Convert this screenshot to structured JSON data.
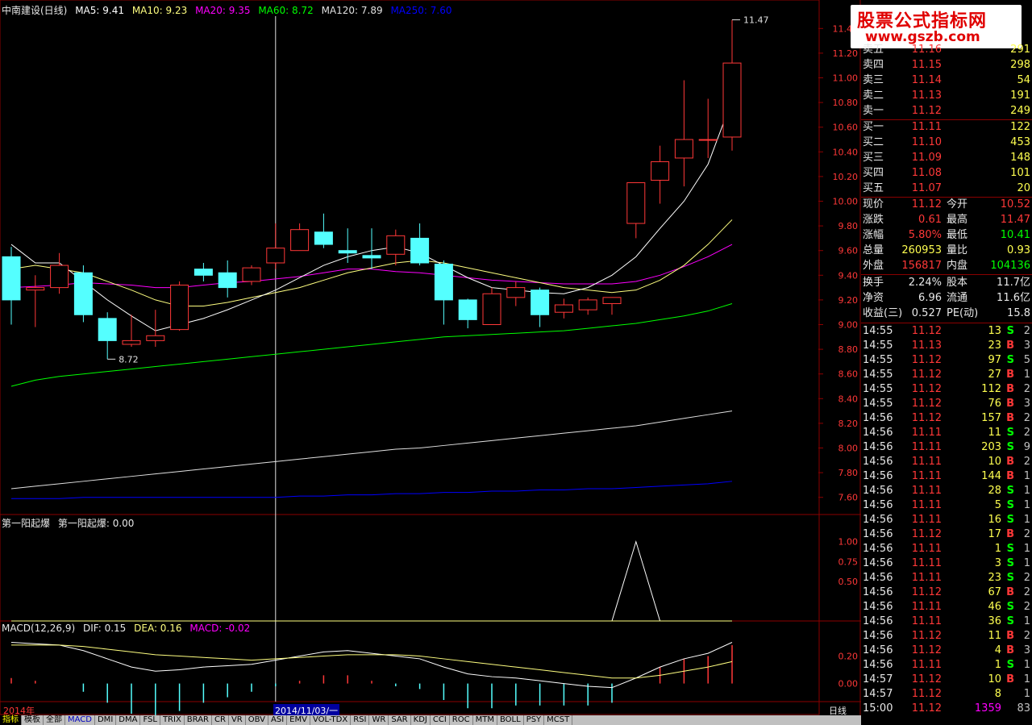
{
  "main_legend": {
    "title": "中南建设(日线)",
    "items": [
      {
        "text": "MA5: 9.41",
        "color": "#ffffff"
      },
      {
        "text": "MA10: 9.23",
        "color": "#ffff80"
      },
      {
        "text": "MA20: 9.35",
        "color": "#ff00ff"
      },
      {
        "text": "MA60: 8.72",
        "color": "#00ff00"
      },
      {
        "text": "MA120: 7.89",
        "color": "#e0e0e0"
      },
      {
        "text": "MA250: 7.60",
        "color": "#0000ff"
      }
    ]
  },
  "logo": {
    "line1": "股票公式指标网",
    "line2": "www.gszb.com"
  },
  "annotations": {
    "high": "11.47",
    "low": "8.72"
  },
  "sub1_legend": {
    "name": "第一阳起爆",
    "value_text": "第一阳起爆: 0.00"
  },
  "sub2_legend": {
    "name": "MACD(12,26,9)",
    "dif": "DIF: 0.15",
    "dea": "DEA: 0.16",
    "macd": "MACD: -0.02"
  },
  "date_axis": {
    "left": "2014年",
    "cursor": "2014/11/03/一"
  },
  "period_label": "日线",
  "price_axis": [
    "11.40",
    "11.20",
    "11.00",
    "10.80",
    "10.60",
    "10.40",
    "10.20",
    "10.00",
    "9.80",
    "9.60",
    "9.40",
    "9.20",
    "9.00",
    "8.80",
    "8.60",
    "8.40",
    "8.20",
    "8.00",
    "7.80",
    "7.60"
  ],
  "sub1_axis": [
    "1.00",
    "0.75",
    "0.50"
  ],
  "sub2_axis": [
    "0.20",
    "0.00"
  ],
  "asks": [
    {
      "label": "卖五",
      "price": "11.16",
      "vol": "291"
    },
    {
      "label": "卖四",
      "price": "11.15",
      "vol": "298"
    },
    {
      "label": "卖三",
      "price": "11.14",
      "vol": "54"
    },
    {
      "label": "卖二",
      "price": "11.13",
      "vol": "191"
    },
    {
      "label": "卖一",
      "price": "11.12",
      "vol": "249"
    }
  ],
  "bids": [
    {
      "label": "买一",
      "price": "11.11",
      "vol": "122"
    },
    {
      "label": "买二",
      "price": "11.10",
      "vol": "453"
    },
    {
      "label": "买三",
      "price": "11.09",
      "vol": "148"
    },
    {
      "label": "买四",
      "price": "11.08",
      "vol": "101"
    },
    {
      "label": "买五",
      "price": "11.07",
      "vol": "20"
    }
  ],
  "quote": [
    {
      "k1": "现价",
      "v1": "11.12",
      "c1": "#ff3838",
      "k2": "今开",
      "v2": "10.52",
      "c2": "#ff3838"
    },
    {
      "k1": "涨跌",
      "v1": "0.61",
      "c1": "#ff3838",
      "k2": "最高",
      "v2": "11.47",
      "c2": "#ff3838"
    },
    {
      "k1": "涨幅",
      "v1": "5.80%",
      "c1": "#ff3838",
      "k2": "最低",
      "v2": "10.41",
      "c2": "#00ff00"
    },
    {
      "k1": "总量",
      "v1": "260953",
      "c1": "#ffff50",
      "k2": "量比",
      "v2": "0.93",
      "c2": "#ffff50"
    },
    {
      "k1": "外盘",
      "v1": "156817",
      "c1": "#ff3838",
      "k2": "内盘",
      "v2": "104136",
      "c2": "#00ff00"
    }
  ],
  "stats": [
    {
      "k1": "换手",
      "v1": "2.24%",
      "k2": "股本",
      "v2": "11.7亿"
    },
    {
      "k1": "净资",
      "v1": "6.96",
      "k2": "流通",
      "v2": "11.6亿"
    },
    {
      "k1": "收益(三)",
      "v1": "0.527",
      "k2": "PE(动)",
      "v2": "15.8"
    }
  ],
  "ticks": [
    {
      "time": "14:55",
      "price": "11.12",
      "vol": "13",
      "side": "S",
      "n": "2"
    },
    {
      "time": "14:55",
      "price": "11.13",
      "vol": "23",
      "side": "B",
      "n": "3"
    },
    {
      "time": "14:55",
      "price": "11.12",
      "vol": "97",
      "side": "S",
      "n": "5"
    },
    {
      "time": "14:55",
      "price": "11.12",
      "vol": "27",
      "side": "B",
      "n": "1"
    },
    {
      "time": "14:55",
      "price": "11.12",
      "vol": "112",
      "side": "B",
      "n": "2"
    },
    {
      "time": "14:55",
      "price": "11.12",
      "vol": "76",
      "side": "B",
      "n": "3"
    },
    {
      "time": "14:56",
      "price": "11.12",
      "vol": "157",
      "side": "B",
      "n": "2"
    },
    {
      "time": "14:56",
      "price": "11.11",
      "vol": "11",
      "side": "S",
      "n": "2"
    },
    {
      "time": "14:56",
      "price": "11.11",
      "vol": "203",
      "side": "S",
      "n": "9"
    },
    {
      "time": "14:56",
      "price": "11.11",
      "vol": "10",
      "side": "B",
      "n": "2"
    },
    {
      "time": "14:56",
      "price": "11.11",
      "vol": "144",
      "side": "B",
      "n": "1"
    },
    {
      "time": "14:56",
      "price": "11.11",
      "vol": "28",
      "side": "S",
      "n": "1"
    },
    {
      "time": "14:56",
      "price": "11.11",
      "vol": "5",
      "side": "S",
      "n": "1"
    },
    {
      "time": "14:56",
      "price": "11.11",
      "vol": "16",
      "side": "S",
      "n": "1"
    },
    {
      "time": "14:56",
      "price": "11.12",
      "vol": "17",
      "side": "B",
      "n": "2"
    },
    {
      "time": "14:56",
      "price": "11.11",
      "vol": "1",
      "side": "S",
      "n": "1"
    },
    {
      "time": "14:56",
      "price": "11.11",
      "vol": "3",
      "side": "S",
      "n": "1"
    },
    {
      "time": "14:56",
      "price": "11.11",
      "vol": "23",
      "side": "S",
      "n": "2"
    },
    {
      "time": "14:56",
      "price": "11.12",
      "vol": "67",
      "side": "B",
      "n": "2"
    },
    {
      "time": "14:56",
      "price": "11.11",
      "vol": "46",
      "side": "S",
      "n": "2"
    },
    {
      "time": "14:56",
      "price": "11.11",
      "vol": "36",
      "side": "S",
      "n": "1"
    },
    {
      "time": "14:56",
      "price": "11.12",
      "vol": "11",
      "side": "B",
      "n": "2"
    },
    {
      "time": "14:56",
      "price": "11.12",
      "vol": "4",
      "side": "B",
      "n": "3"
    },
    {
      "time": "14:56",
      "price": "11.11",
      "vol": "1",
      "side": "S",
      "n": "1"
    },
    {
      "time": "14:57",
      "price": "11.12",
      "vol": "10",
      "side": "B",
      "n": "1"
    },
    {
      "time": "14:57",
      "price": "11.12",
      "vol": "8",
      "side": "",
      "n": "1"
    },
    {
      "time": "15:00",
      "price": "11.12",
      "vol": "1359",
      "side": "",
      "n": "83"
    }
  ],
  "tabs": [
    "指标",
    "模板",
    "全部",
    "MACD",
    "DMI",
    "DMA",
    "FSL",
    "TRIX",
    "BRAR",
    "CR",
    "VR",
    "OBV",
    "ASI",
    "EMV",
    "VOL-TDX",
    "RSI",
    "WR",
    "SAR",
    "KDJ",
    "CCI",
    "ROC",
    "MTM",
    "BOLL",
    "PSY",
    "MCST"
  ],
  "colors": {
    "up": "#ff3838",
    "down": "#54ffff",
    "grid": "#8b0000"
  },
  "chart_data": {
    "type": "candlestick",
    "price_ylim": [
      7.5,
      11.5
    ],
    "candles": [
      {
        "o": 9.55,
        "h": 9.63,
        "l": 9.0,
        "c": 9.2
      },
      {
        "o": 9.28,
        "h": 9.4,
        "l": 8.98,
        "c": 9.3
      },
      {
        "o": 9.3,
        "h": 9.58,
        "l": 9.25,
        "c": 9.48
      },
      {
        "o": 9.42,
        "h": 9.48,
        "l": 9.02,
        "c": 9.08
      },
      {
        "o": 9.05,
        "h": 9.1,
        "l": 8.72,
        "c": 8.87
      },
      {
        "o": 8.84,
        "h": 9.08,
        "l": 8.82,
        "c": 8.87
      },
      {
        "o": 8.87,
        "h": 9.12,
        "l": 8.82,
        "c": 8.91
      },
      {
        "o": 8.96,
        "h": 9.35,
        "l": 8.95,
        "c": 9.32
      },
      {
        "o": 9.45,
        "h": 9.5,
        "l": 9.35,
        "c": 9.4
      },
      {
        "o": 9.42,
        "h": 9.52,
        "l": 9.22,
        "c": 9.3
      },
      {
        "o": 9.35,
        "h": 9.48,
        "l": 9.32,
        "c": 9.46
      },
      {
        "o": 9.5,
        "h": 9.82,
        "l": 9.45,
        "c": 9.62
      },
      {
        "o": 9.6,
        "h": 9.82,
        "l": 9.62,
        "c": 9.77
      },
      {
        "o": 9.75,
        "h": 9.9,
        "l": 9.62,
        "c": 9.65
      },
      {
        "o": 9.6,
        "h": 9.78,
        "l": 9.5,
        "c": 9.58
      },
      {
        "o": 9.56,
        "h": 9.78,
        "l": 9.45,
        "c": 9.54
      },
      {
        "o": 9.57,
        "h": 9.77,
        "l": 9.48,
        "c": 9.72
      },
      {
        "o": 9.7,
        "h": 9.82,
        "l": 9.48,
        "c": 9.5
      },
      {
        "o": 9.49,
        "h": 9.52,
        "l": 9.0,
        "c": 9.2
      },
      {
        "o": 9.2,
        "h": 9.21,
        "l": 8.97,
        "c": 9.04
      },
      {
        "o": 9.0,
        "h": 9.3,
        "l": 9.0,
        "c": 9.25
      },
      {
        "o": 9.22,
        "h": 9.35,
        "l": 9.15,
        "c": 9.3
      },
      {
        "o": 9.28,
        "h": 9.3,
        "l": 8.98,
        "c": 9.08
      },
      {
        "o": 9.1,
        "h": 9.21,
        "l": 9.05,
        "c": 9.16
      },
      {
        "o": 9.12,
        "h": 9.22,
        "l": 9.08,
        "c": 9.2
      },
      {
        "o": 9.17,
        "h": 9.22,
        "l": 9.08,
        "c": 9.22
      },
      {
        "o": 9.82,
        "h": 10.15,
        "l": 9.7,
        "c": 10.15
      },
      {
        "o": 10.17,
        "h": 10.45,
        "l": 9.98,
        "c": 10.32
      },
      {
        "o": 10.35,
        "h": 10.98,
        "l": 10.12,
        "c": 10.5
      },
      {
        "o": 10.5,
        "h": 10.83,
        "l": 10.35,
        "c": 10.5
      },
      {
        "o": 10.52,
        "h": 11.47,
        "l": 10.41,
        "c": 11.12
      }
    ],
    "ma5": [
      9.65,
      9.5,
      9.5,
      9.35,
      9.2,
      9.07,
      8.95,
      9.0,
      9.05,
      9.12,
      9.2,
      9.28,
      9.38,
      9.48,
      9.55,
      9.6,
      9.63,
      9.58,
      9.48,
      9.38,
      9.3,
      9.28,
      9.26,
      9.25,
      9.3,
      9.4,
      9.55,
      9.78,
      10.0,
      10.3,
      10.82
    ],
    "ma10": [
      9.45,
      9.48,
      9.45,
      9.42,
      9.35,
      9.28,
      9.2,
      9.15,
      9.15,
      9.18,
      9.22,
      9.26,
      9.3,
      9.36,
      9.42,
      9.46,
      9.5,
      9.52,
      9.5,
      9.46,
      9.42,
      9.38,
      9.34,
      9.3,
      9.28,
      9.26,
      9.28,
      9.36,
      9.48,
      9.65,
      9.85
    ],
    "ma20": [
      9.3,
      9.31,
      9.32,
      9.34,
      9.33,
      9.32,
      9.3,
      9.3,
      9.32,
      9.34,
      9.35,
      9.37,
      9.39,
      9.42,
      9.45,
      9.45,
      9.43,
      9.42,
      9.4,
      9.38,
      9.36,
      9.35,
      9.34,
      9.33,
      9.33,
      9.33,
      9.35,
      9.4,
      9.47,
      9.55,
      9.65
    ],
    "ma60": [
      8.5,
      8.55,
      8.58,
      8.6,
      8.62,
      8.64,
      8.66,
      8.68,
      8.7,
      8.72,
      8.74,
      8.76,
      8.78,
      8.8,
      8.82,
      8.84,
      8.86,
      8.88,
      8.9,
      8.91,
      8.92,
      8.93,
      8.94,
      8.95,
      8.97,
      8.99,
      9.01,
      9.04,
      9.07,
      9.11,
      9.17
    ],
    "ma120": [
      7.67,
      7.69,
      7.71,
      7.73,
      7.75,
      7.77,
      7.79,
      7.81,
      7.83,
      7.85,
      7.87,
      7.89,
      7.91,
      7.93,
      7.95,
      7.97,
      7.99,
      8.0,
      8.02,
      8.04,
      8.06,
      8.08,
      8.1,
      8.12,
      8.14,
      8.16,
      8.18,
      8.21,
      8.24,
      8.27,
      8.3
    ],
    "ma250": [
      7.59,
      7.59,
      7.59,
      7.6,
      7.6,
      7.6,
      7.6,
      7.6,
      7.6,
      7.6,
      7.6,
      7.6,
      7.61,
      7.61,
      7.62,
      7.62,
      7.63,
      7.63,
      7.64,
      7.64,
      7.65,
      7.65,
      7.66,
      7.66,
      7.67,
      7.67,
      7.68,
      7.69,
      7.7,
      7.71,
      7.73
    ],
    "signal": [
      0,
      0,
      0,
      0,
      0,
      0,
      0,
      0,
      0,
      0,
      0,
      0,
      0,
      0,
      0,
      0,
      0,
      0,
      0,
      0,
      0,
      0,
      0,
      0,
      0,
      0,
      1,
      0,
      0,
      0,
      0
    ],
    "signal_ylim": [
      0,
      1.2
    ],
    "dif": [
      0.3,
      0.29,
      0.28,
      0.24,
      0.18,
      0.12,
      0.09,
      0.1,
      0.12,
      0.13,
      0.14,
      0.17,
      0.2,
      0.23,
      0.24,
      0.22,
      0.2,
      0.18,
      0.12,
      0.07,
      0.05,
      0.04,
      0.02,
      0.0,
      -0.02,
      -0.03,
      0.04,
      0.12,
      0.18,
      0.22,
      0.3
    ],
    "dea": [
      0.28,
      0.28,
      0.28,
      0.27,
      0.25,
      0.23,
      0.21,
      0.2,
      0.19,
      0.18,
      0.17,
      0.18,
      0.19,
      0.2,
      0.21,
      0.21,
      0.21,
      0.2,
      0.18,
      0.16,
      0.14,
      0.12,
      0.1,
      0.08,
      0.06,
      0.04,
      0.04,
      0.06,
      0.09,
      0.12,
      0.16
    ],
    "macd_ylim": [
      -0.12,
      0.35
    ]
  }
}
